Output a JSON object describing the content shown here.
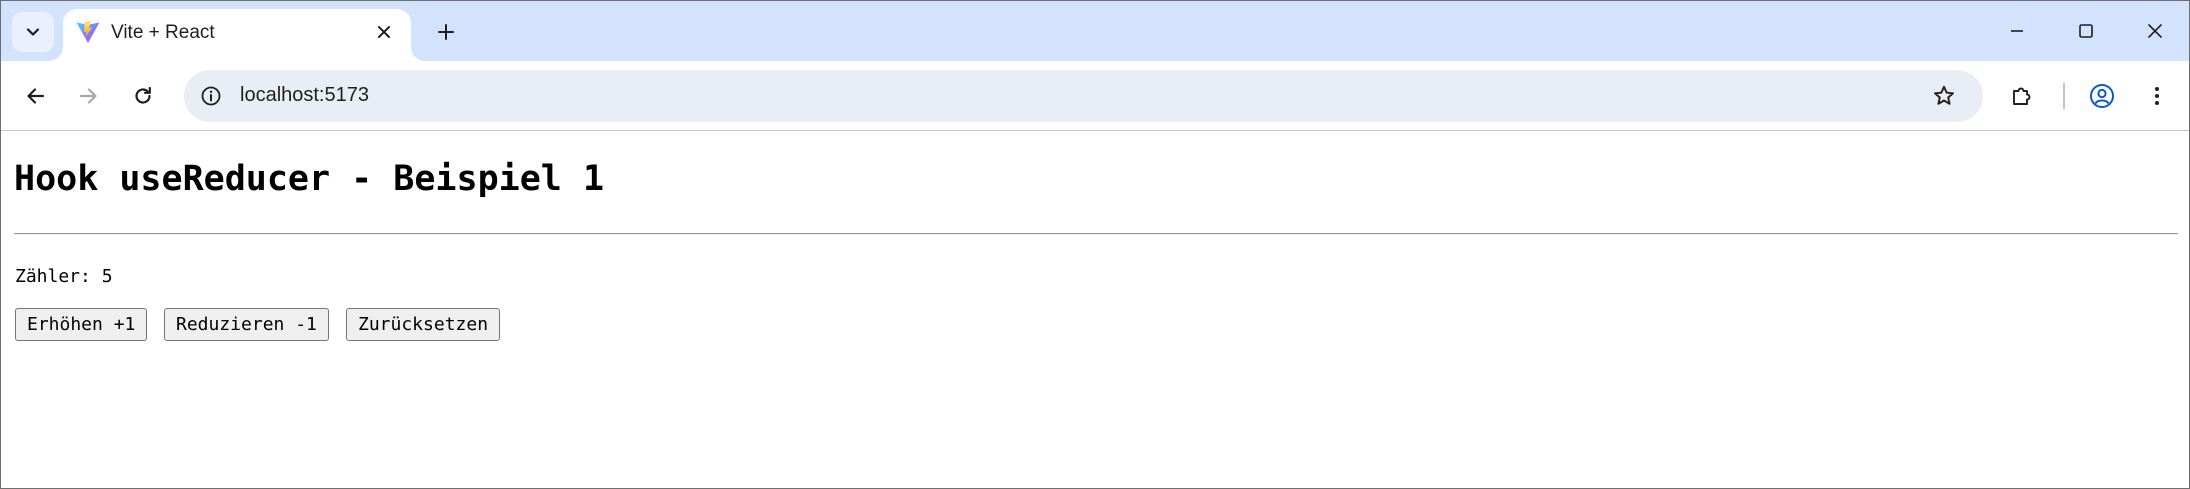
{
  "browser": {
    "tab": {
      "title": "Vite + React"
    },
    "address_bar": {
      "url": "localhost:5173"
    },
    "icons": {
      "tab_search": "chevron-down-icon",
      "favicon": "vite-logo-icon",
      "tab_close": "close-icon",
      "new_tab": "plus-icon",
      "back": "arrow-left-icon",
      "forward": "arrow-right-icon",
      "reload": "reload-icon",
      "site_info": "info-icon",
      "bookmark": "star-icon",
      "extensions": "puzzle-icon",
      "profile": "profile-icon",
      "menu": "kebab-menu-icon",
      "minimize": "minimize-icon",
      "maximize": "maximize-icon",
      "close_window": "close-icon"
    }
  },
  "page": {
    "title": "Hook useReducer - Beispiel 1",
    "counter_text": "Zähler: 5",
    "buttons": {
      "increment": "Erhöhen +1",
      "decrement": "Reduzieren -1",
      "reset": "Zurücksetzen"
    }
  },
  "colors": {
    "tabstrip_bg": "#d3e3fd",
    "omnibox_bg": "#e9eef6",
    "profile_accent": "#0b57d0"
  }
}
